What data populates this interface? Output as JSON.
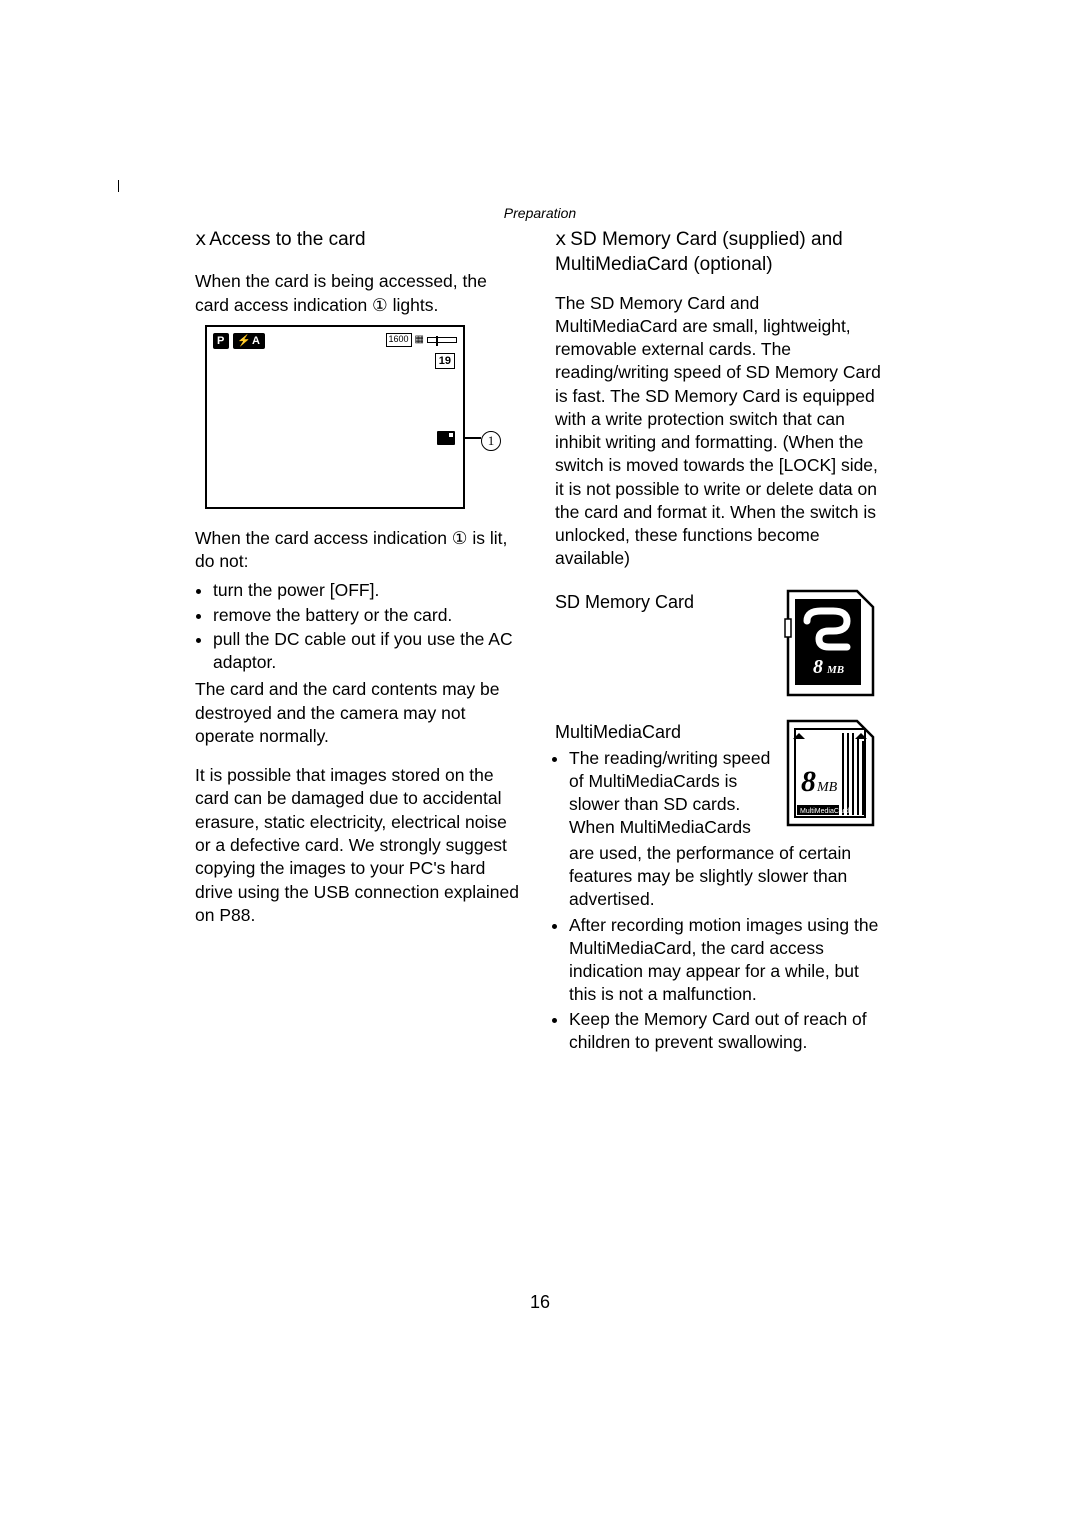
{
  "section_label": "Preparation",
  "left": {
    "heading_prefix": "x",
    "heading": "Access to the card",
    "intro": "When the card is being accessed, the card access indication ① lights.",
    "screen": {
      "mode_badge": "P",
      "flash_badge": "⚡A",
      "res_badge": "1600",
      "counter": "19",
      "callout_num": "1"
    },
    "warn_intro": "When the card access indication ① is lit, do not:",
    "bullets": [
      "turn the power [OFF].",
      "remove the battery or the card.",
      "pull the DC cable out if you use the AC adaptor."
    ],
    "warn_after": "The card and the card contents may be destroyed and the camera may not operate normally.",
    "note": "It is possible that images stored on the card can be damaged due to accidental erasure, static electricity, electrical noise or a defective card. We strongly suggest copying the images to your PC's hard drive using the USB connection explained on P88."
  },
  "right": {
    "heading_prefix": "x",
    "heading": "SD Memory Card (supplied) and MultiMediaCard (optional)",
    "intro": "The SD Memory Card and MultiMediaCard are small, lightweight, removable external cards. The reading/writing speed of SD Memory Card is fast. The SD Memory Card is equipped with a write protection switch that can inhibit writing and formatting. (When the switch is moved towards the [LOCK] side, it is not possible to write or delete data on the card and format it. When the switch is unlocked, these functions become available)",
    "sd_label": "SD Memory Card",
    "sd_capacity": "8",
    "sd_unit": "MB",
    "mmc_label": "MultiMediaCard",
    "mmc_capacity": "8",
    "mmc_unit": "MB",
    "mmc_sub": "MultiMediaCard",
    "mmc_bullets": [
      "The reading/writing speed of MultiMediaCards is slower than SD cards. When MultiMediaCards are used, the performance of certain features may be slightly slower than advertised.",
      "After recording motion images using the MultiMediaCard, the card access indication may appear for a while, but this is not a malfunction.",
      "Keep the Memory Card out of reach of children to prevent swallowing."
    ]
  },
  "page_number": "16"
}
